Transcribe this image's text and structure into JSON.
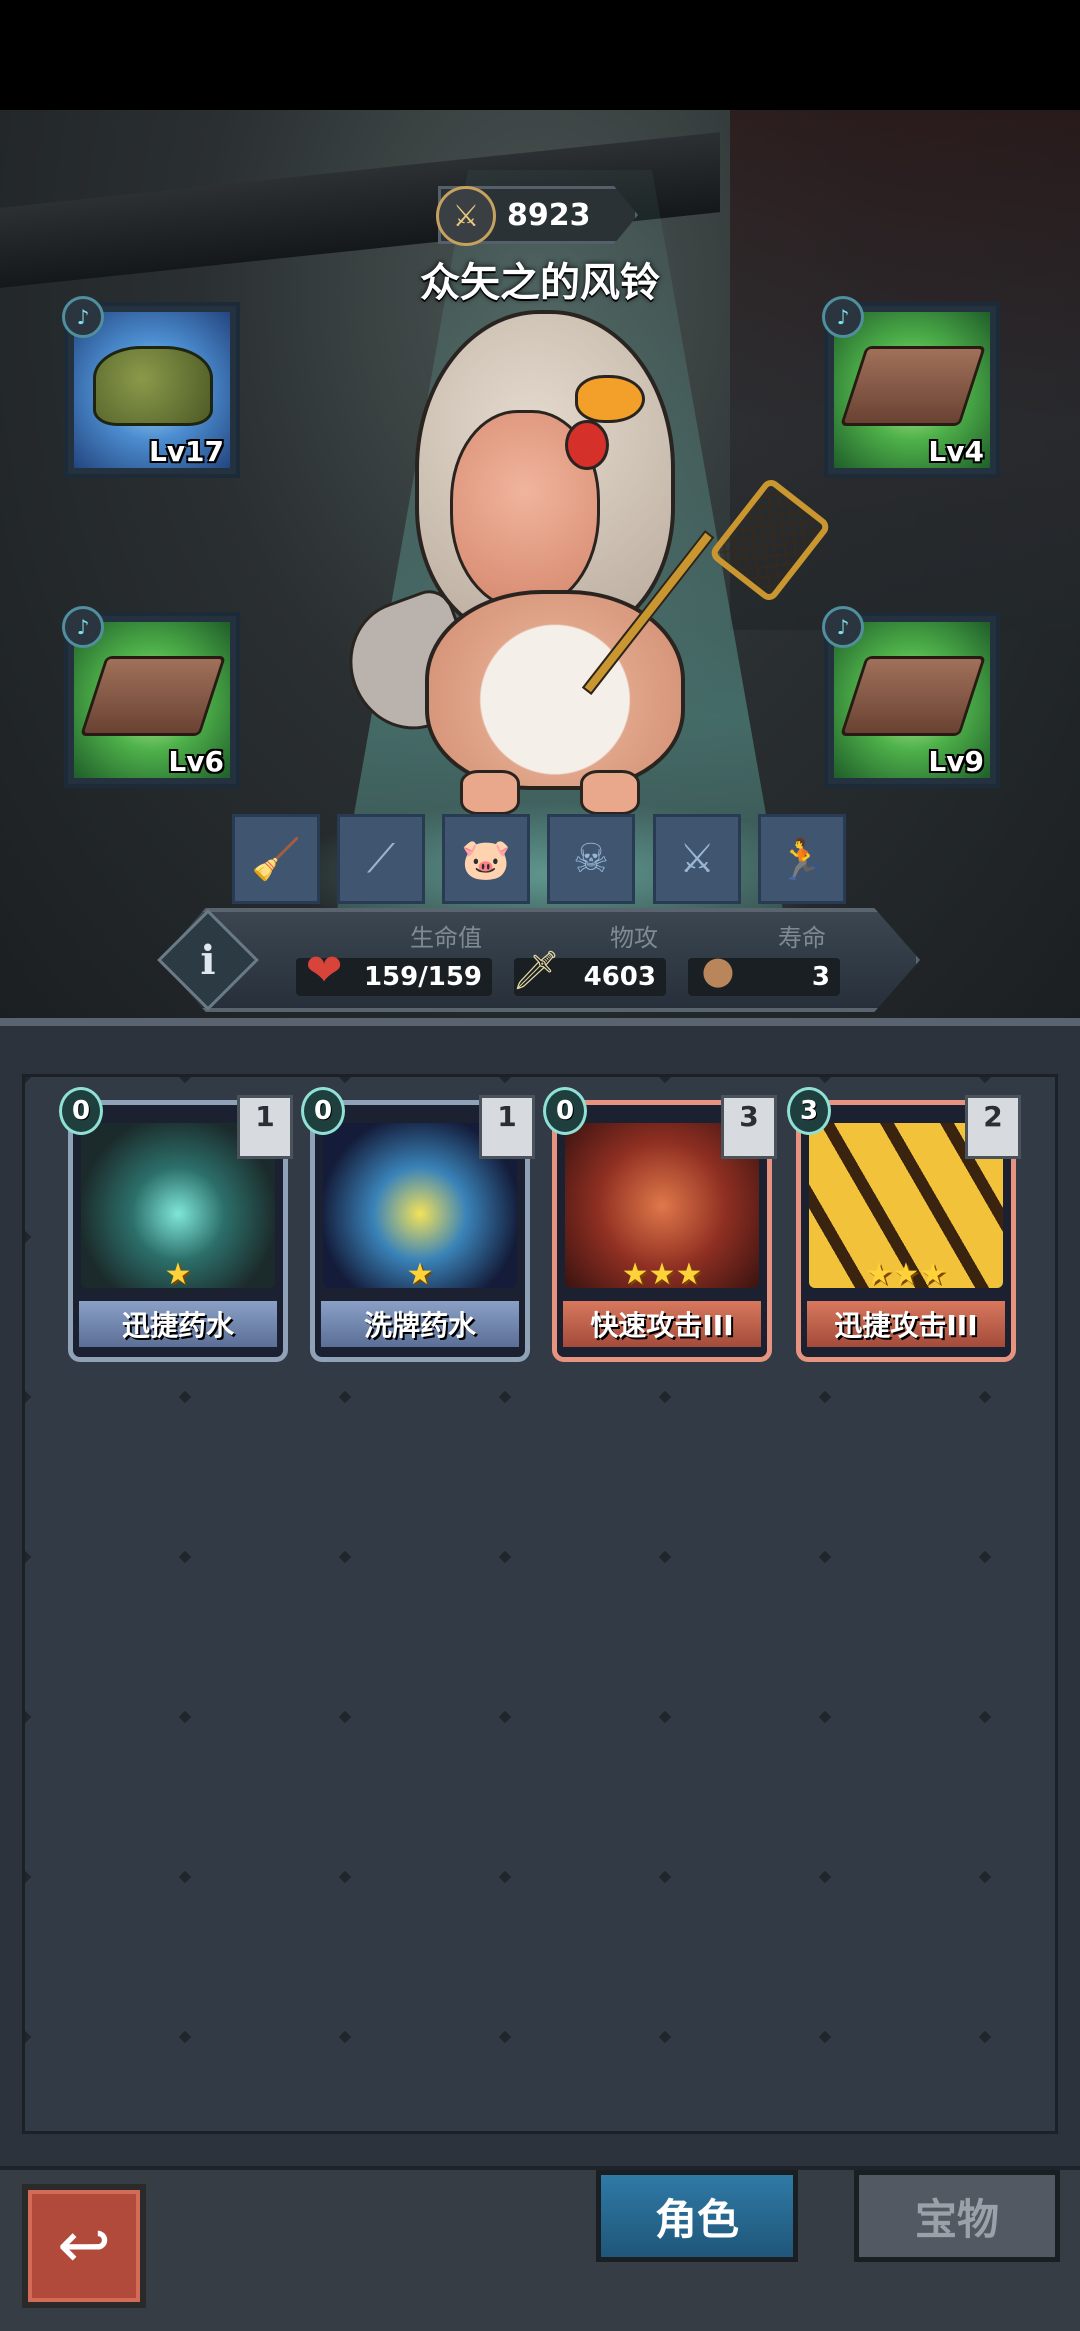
{
  "hero": {
    "power": "8923",
    "name": "众矢之的风铃"
  },
  "equipment": [
    {
      "level": "Lv17",
      "rarity_color": "#4c8ed1",
      "icon": "boots-icon"
    },
    {
      "level": "Lv4",
      "rarity_color": "#4fb24a",
      "icon": "board-icon"
    },
    {
      "level": "Lv6",
      "rarity_color": "#4fb24a",
      "icon": "board-icon"
    },
    {
      "level": "Lv9",
      "rarity_color": "#4fb24a",
      "icon": "board-icon"
    }
  ],
  "skills": [
    "broom-icon",
    "stick-icon",
    "pig-icon",
    "skull-icon",
    "swords-icon",
    "runner-icon"
  ],
  "stats": {
    "hp_label": "生命值",
    "hp_value": "159/159",
    "atk_label": "物攻",
    "atk_value": "4603",
    "life_label": "寿命",
    "life_value": "3"
  },
  "cards": [
    {
      "name": "迅捷药水",
      "cost": "0",
      "count": "1",
      "stars": "★",
      "color": "blue"
    },
    {
      "name": "洗牌药水",
      "cost": "0",
      "count": "1",
      "stars": "★",
      "color": "blue"
    },
    {
      "name": "快速攻击III",
      "cost": "0",
      "count": "3",
      "stars": "★★★",
      "color": "orange"
    },
    {
      "name": "迅捷攻击III",
      "cost": "3",
      "count": "2",
      "stars": "★★★",
      "color": "orange"
    }
  ],
  "nav": {
    "tab_character": "角色",
    "tab_treasure": "宝物"
  }
}
